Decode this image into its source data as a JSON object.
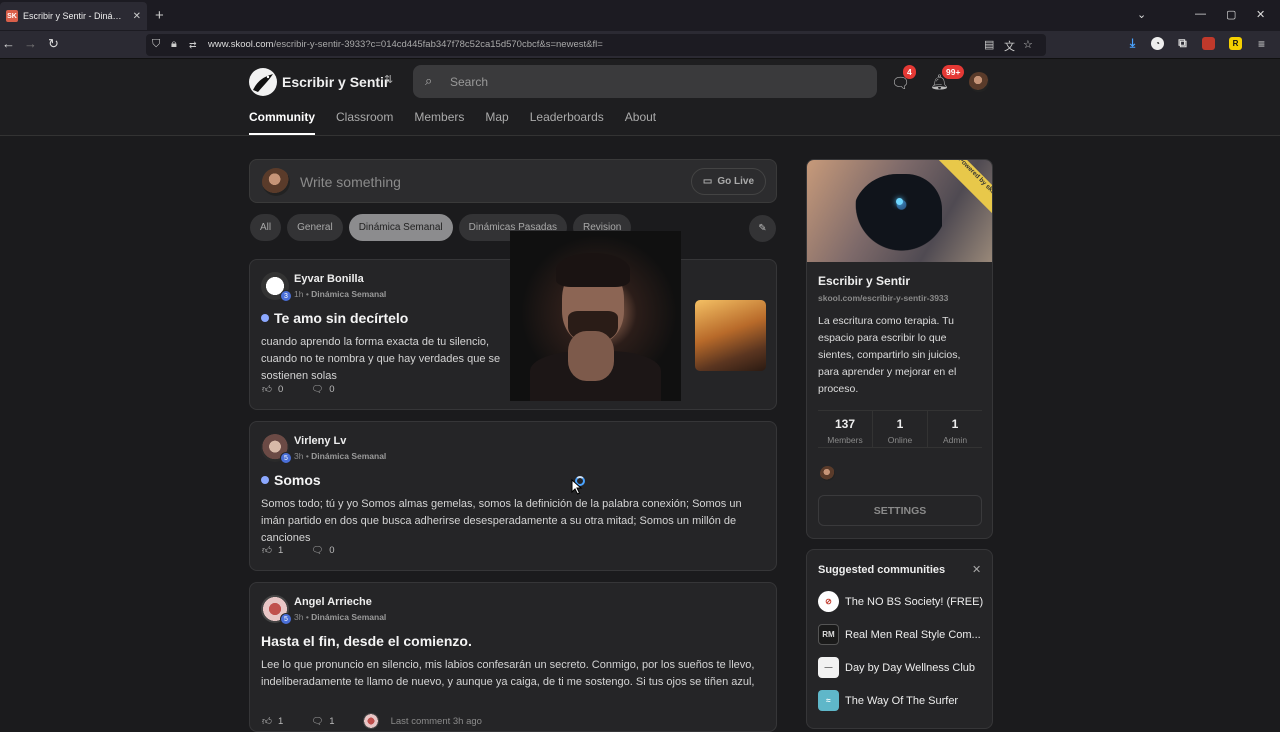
{
  "browser": {
    "tab_title": "Escribir y Sentir - Dinámica Semanal",
    "favicon_text": "SK",
    "url_domain": "www.skool.com",
    "url_path": "/escribir-y-sentir-3933?c=014cd445fab347f78c52ca15d570cbcf&s=newest&fl=",
    "ext_badge": "25"
  },
  "header": {
    "community_name": "Escribir y Sentir",
    "search_placeholder": "Search",
    "chat_badge": "4",
    "notif_badge": "99+"
  },
  "nav": {
    "tabs": [
      "Community",
      "Classroom",
      "Members",
      "Map",
      "Leaderboards",
      "About"
    ],
    "active": "Community"
  },
  "composer": {
    "placeholder": "Write something",
    "go_live": "Go Live"
  },
  "filters": [
    "All",
    "General",
    "Dinámica Semanal",
    "Dinámicas Pasadas",
    "Revision"
  ],
  "posts": [
    {
      "author": "Eyvar Bonilla",
      "level": "3",
      "time": "1h",
      "category": "Dinámica Semanal",
      "title": "Te amo sin decírtelo",
      "body": "cuando aprendo la forma exacta de tu silencio, cuando no te nombra y que hay verdades que se sostienen solas",
      "likes": "0",
      "comments": "0"
    },
    {
      "author": "Virleny Lv",
      "level": "5",
      "time": "3h",
      "category": "Dinámica Semanal",
      "title": "Somos",
      "body": "Somos todo; tú y yo Somos almas gemelas, somos la definición de la palabra conexión; Somos un imán partido en dos que busca adherirse desesperadamente a su otra mitad; Somos un millón de canciones",
      "likes": "1",
      "comments": "0"
    },
    {
      "author": "Angel Arrieche",
      "level": "5",
      "time": "3h",
      "category": "Dinámica Semanal",
      "title": "Hasta el fin, desde el comienzo.",
      "body": "Lee lo que pronuncio en silencio, mis labios confesarán un secreto. Conmigo, por los sueños te llevo, indeliberadamente te llamo de nuevo, y aunque ya caiga, de ti me sostengo. Si tus ojos se tiñen azul,",
      "likes": "1",
      "comments": "1",
      "last_comment": "Last comment 3h ago"
    }
  ],
  "sidebar": {
    "ribbon": "Powered by skool",
    "name": "Escribir y Sentir",
    "url": "skool.com/escribir-y-sentir-3933",
    "description": "La escritura como terapia. Tu espacio para escribir lo que sientes, compartirlo sin juicios, para aprender y mejorar en el proceso.",
    "stats": [
      {
        "value": "137",
        "label": "Members"
      },
      {
        "value": "1",
        "label": "Online"
      },
      {
        "value": "1",
        "label": "Admin"
      }
    ],
    "settings": "SETTINGS"
  },
  "suggested": {
    "heading": "Suggested communities",
    "items": [
      {
        "name": "The NO BS Society! (FREE)",
        "color": "#ffffff"
      },
      {
        "name": "Real Men Real Style Com...",
        "color": "#1a1a1a"
      },
      {
        "name": "Day by Day Wellness Club",
        "color": "#f2f2f2"
      },
      {
        "name": "The Way Of The Surfer",
        "color": "#5fb7c9"
      }
    ]
  }
}
